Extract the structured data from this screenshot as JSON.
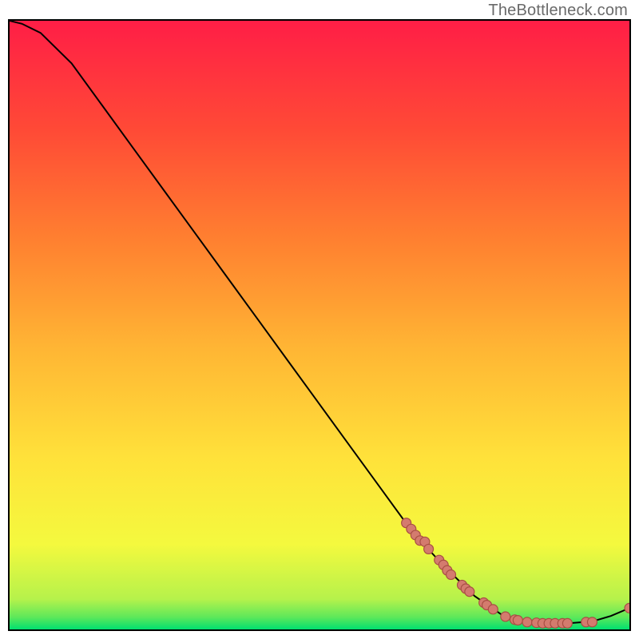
{
  "watermark": "TheBottleneck.com",
  "colors": {
    "curve": "#000000",
    "dot_fill": "#d47b6e",
    "dot_stroke": "#a84e43",
    "gradient_top": "#ff1e46",
    "gradient_bottom": "#00e070"
  },
  "chart_data": {
    "type": "line",
    "title": "",
    "xlabel": "",
    "ylabel": "",
    "xlim": [
      0,
      100
    ],
    "ylim": [
      0,
      100
    ],
    "axes_visible": false,
    "grid": false,
    "curve": [
      {
        "x": 0,
        "y": 100
      },
      {
        "x": 2,
        "y": 99.5
      },
      {
        "x": 5,
        "y": 98
      },
      {
        "x": 10,
        "y": 93
      },
      {
        "x": 15,
        "y": 86
      },
      {
        "x": 20,
        "y": 79
      },
      {
        "x": 25,
        "y": 72
      },
      {
        "x": 30,
        "y": 65
      },
      {
        "x": 35,
        "y": 58
      },
      {
        "x": 40,
        "y": 51
      },
      {
        "x": 45,
        "y": 44
      },
      {
        "x": 50,
        "y": 37
      },
      {
        "x": 55,
        "y": 30
      },
      {
        "x": 60,
        "y": 23
      },
      {
        "x": 65,
        "y": 16
      },
      {
        "x": 70,
        "y": 10.5
      },
      {
        "x": 75,
        "y": 5.5
      },
      {
        "x": 80,
        "y": 2
      },
      {
        "x": 85,
        "y": 1
      },
      {
        "x": 90,
        "y": 1
      },
      {
        "x": 94,
        "y": 1.3
      },
      {
        "x": 97,
        "y": 2.2
      },
      {
        "x": 100,
        "y": 3.5
      }
    ],
    "points": [
      {
        "x": 64,
        "y": 17.5
      },
      {
        "x": 64.8,
        "y": 16.5
      },
      {
        "x": 65.5,
        "y": 15.5
      },
      {
        "x": 66.2,
        "y": 14.6
      },
      {
        "x": 67,
        "y": 14.4
      },
      {
        "x": 67.6,
        "y": 13.2
      },
      {
        "x": 69.3,
        "y": 11.4
      },
      {
        "x": 70,
        "y": 10.6
      },
      {
        "x": 70.6,
        "y": 9.7
      },
      {
        "x": 71.2,
        "y": 9
      },
      {
        "x": 73,
        "y": 7.3
      },
      {
        "x": 73.6,
        "y": 6.7
      },
      {
        "x": 74.2,
        "y": 6.2
      },
      {
        "x": 76.5,
        "y": 4.4
      },
      {
        "x": 77,
        "y": 4
      },
      {
        "x": 78,
        "y": 3.3
      },
      {
        "x": 80,
        "y": 2.1
      },
      {
        "x": 81.5,
        "y": 1.6
      },
      {
        "x": 82,
        "y": 1.5
      },
      {
        "x": 83.5,
        "y": 1.2
      },
      {
        "x": 85,
        "y": 1.1
      },
      {
        "x": 86,
        "y": 1
      },
      {
        "x": 87,
        "y": 1
      },
      {
        "x": 88,
        "y": 1
      },
      {
        "x": 89.2,
        "y": 1
      },
      {
        "x": 90,
        "y": 1
      },
      {
        "x": 93,
        "y": 1.2
      },
      {
        "x": 94,
        "y": 1.2
      },
      {
        "x": 100,
        "y": 3.5
      }
    ]
  }
}
